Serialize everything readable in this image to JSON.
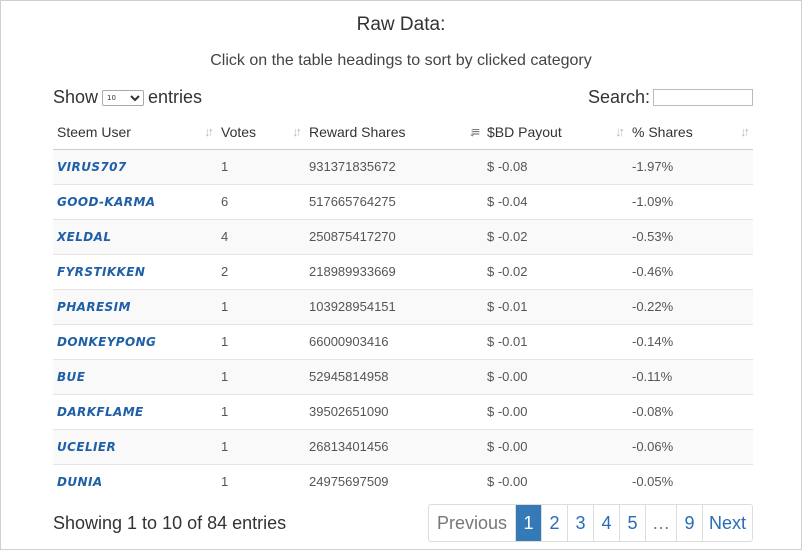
{
  "title": "Raw Data:",
  "subtitle": "Click on the table headings to sort by clicked category",
  "length": {
    "show_label": "Show",
    "entries_label": "entries",
    "selected": "10"
  },
  "search": {
    "label": "Search:",
    "value": ""
  },
  "table": {
    "headers": [
      "Steem User",
      "Votes",
      "Reward Shares",
      "$BD Payout",
      "% Shares"
    ],
    "rows": [
      [
        "VIRUS707",
        "1",
        "931371835672",
        "$ -0.08",
        "-1.97%"
      ],
      [
        "GOOD-KARMA",
        "6",
        "517665764275",
        "$ -0.04",
        "-1.09%"
      ],
      [
        "XELDAL",
        "4",
        "250875417270",
        "$ -0.02",
        "-0.53%"
      ],
      [
        "FYRSTIKKEN",
        "2",
        "218989933669",
        "$ -0.02",
        "-0.46%"
      ],
      [
        "PHARESIM",
        "1",
        "103928954151",
        "$ -0.01",
        "-0.22%"
      ],
      [
        "DONKEYPONG",
        "1",
        "66000903416",
        "$ -0.01",
        "-0.14%"
      ],
      [
        "BUE",
        "1",
        "52945814958",
        "$ -0.00",
        "-0.11%"
      ],
      [
        "DARKFLAME",
        "1",
        "39502651090",
        "$ -0.00",
        "-0.08%"
      ],
      [
        "UCELIER",
        "1",
        "26813401456",
        "$ -0.00",
        "-0.06%"
      ],
      [
        "DUNIA",
        "1",
        "24975697509",
        "$ -0.00",
        "-0.05%"
      ]
    ]
  },
  "info": "Showing 1 to 10 of 84 entries",
  "pagination": {
    "previous": "Previous",
    "pages": [
      "1",
      "2",
      "3",
      "4",
      "5"
    ],
    "ellipsis": "…",
    "last": "9",
    "next": "Next",
    "current": "1"
  },
  "colors": {
    "accent": "#337ab7",
    "user_link": "#1f5fa8",
    "stripe": "#f9f9f9"
  }
}
